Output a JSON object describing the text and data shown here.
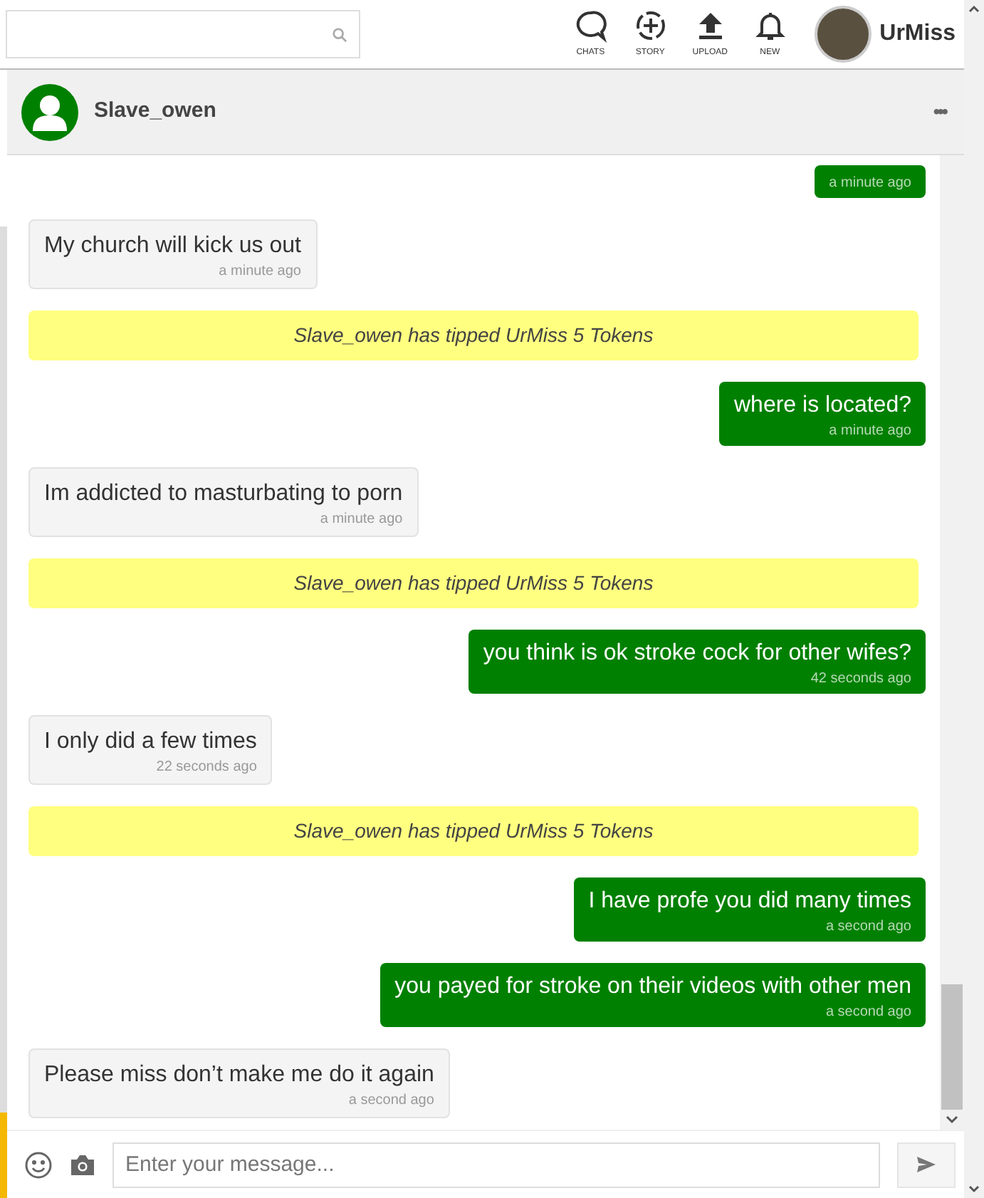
{
  "nav": [
    {
      "kind": "chats",
      "label": "CHATS"
    },
    {
      "kind": "story",
      "label": "STORY"
    },
    {
      "kind": "upload",
      "label": "UPLOAD"
    },
    {
      "kind": "new",
      "label": "NEW"
    }
  ],
  "user": {
    "name": "UrMiss"
  },
  "conversation": {
    "name": "Slave_owen",
    "menu": "•••"
  },
  "messages": [
    {
      "kind": "sent",
      "time": "a minute ago"
    },
    {
      "kind": "received",
      "text": "My church will kick us out",
      "time": "a minute ago"
    },
    {
      "kind": "tip",
      "text": "Slave_owen has tipped UrMiss 5 Tokens"
    },
    {
      "kind": "sent",
      "text": "where is located?",
      "time": "a minute ago"
    },
    {
      "kind": "received",
      "text": "Im addicted to masturbating to porn",
      "time": "a minute ago"
    },
    {
      "kind": "tip",
      "text": "Slave_owen has tipped UrMiss 5 Tokens"
    },
    {
      "kind": "sent",
      "text": "you think is ok stroke cock for other wifes?",
      "time": "42 seconds ago"
    },
    {
      "kind": "received",
      "text": "I only did a few times",
      "time": "22 seconds ago"
    },
    {
      "kind": "tip",
      "text": "Slave_owen has tipped UrMiss 5 Tokens"
    },
    {
      "kind": "sent",
      "text": "I have profe you did many times",
      "time": "a second ago"
    },
    {
      "kind": "sent",
      "text": "you payed for stroke on their videos with other men",
      "time": "a second ago"
    },
    {
      "kind": "received",
      "text": "Please miss don’t make me do it again",
      "time": "a second ago"
    }
  ],
  "composer": {
    "placeholder": "Enter your message..."
  }
}
